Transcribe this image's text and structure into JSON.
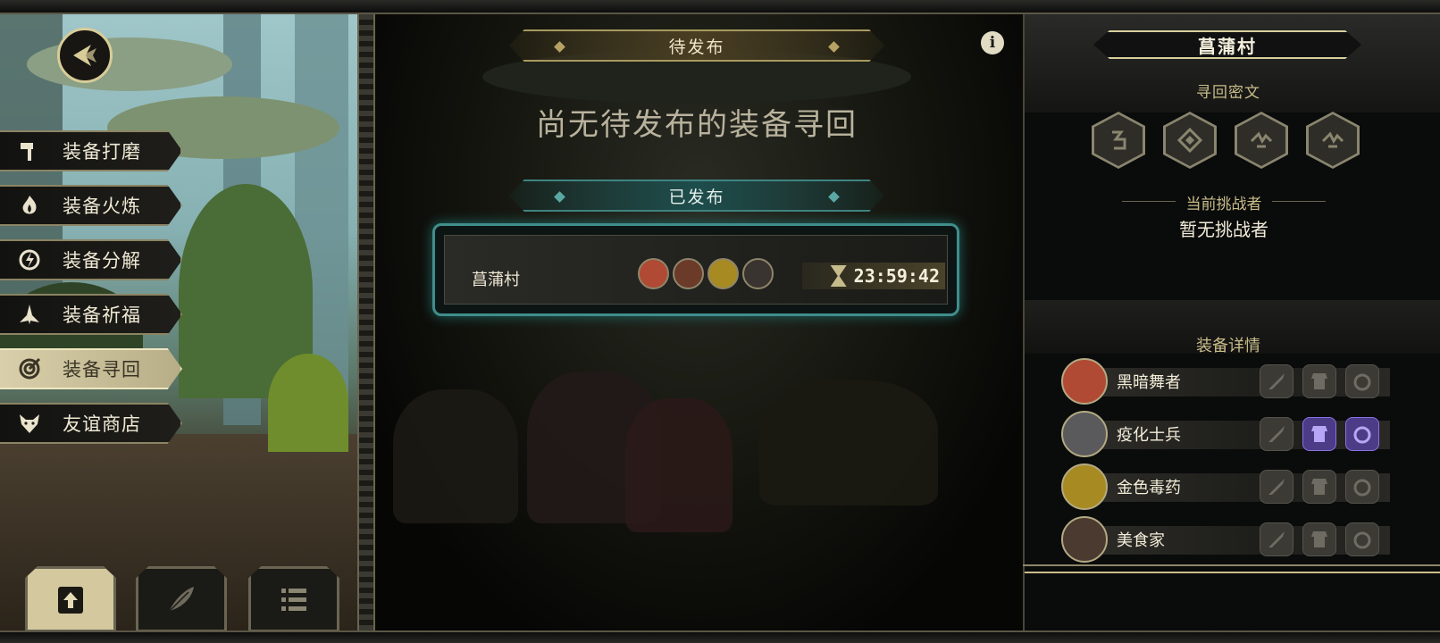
{
  "sidebar": {
    "items": [
      {
        "label": "装备打磨",
        "icon": "hammer-icon",
        "active": false
      },
      {
        "label": "装备火炼",
        "icon": "flame-icon",
        "active": false
      },
      {
        "label": "装备分解",
        "icon": "dismantle-icon",
        "active": false
      },
      {
        "label": "装备祈福",
        "icon": "blessing-icon",
        "active": false
      },
      {
        "label": "装备寻回",
        "icon": "target-icon",
        "active": true
      },
      {
        "label": "友谊商店",
        "icon": "fox-icon",
        "active": false
      }
    ],
    "bottom_buttons": [
      {
        "icon": "upload-icon",
        "active": true
      },
      {
        "icon": "feather-icon",
        "active": false
      },
      {
        "icon": "list-icon",
        "active": false
      }
    ]
  },
  "center": {
    "pending_label": "待发布",
    "empty_text": "尚无待发布的装备寻回",
    "published_label": "已发布",
    "quest": {
      "location": "菖蒲村",
      "timer": "23:59:42",
      "avatars": [
        "dancer",
        "soldier",
        "poison",
        "gourmet"
      ]
    }
  },
  "right_panel": {
    "title": "菖蒲村",
    "runes_title": "寻回密文",
    "runes": [
      "rune-1-icon",
      "rune-2-icon",
      "rune-3-icon",
      "rune-4-icon"
    ],
    "challenger_title": "当前挑战者",
    "challenger_value": "暂无挑战者",
    "detail_title": "装备详情",
    "heroes": [
      {
        "name": "黑暗舞者",
        "color": "#b04a34",
        "slots": [
          false,
          false,
          false
        ]
      },
      {
        "name": "疫化士兵",
        "color": "#5a5a5c",
        "slots": [
          false,
          true,
          true
        ]
      },
      {
        "name": "金色毒药",
        "color": "#a88a22",
        "slots": [
          false,
          false,
          false
        ]
      },
      {
        "name": "美食家",
        "color": "#4a3a30",
        "slots": [
          false,
          false,
          false
        ]
      }
    ]
  },
  "colors": {
    "accent_gold": "#d8cc98",
    "accent_teal": "#3f8e8c",
    "purple_slot": "#4c3b86"
  }
}
